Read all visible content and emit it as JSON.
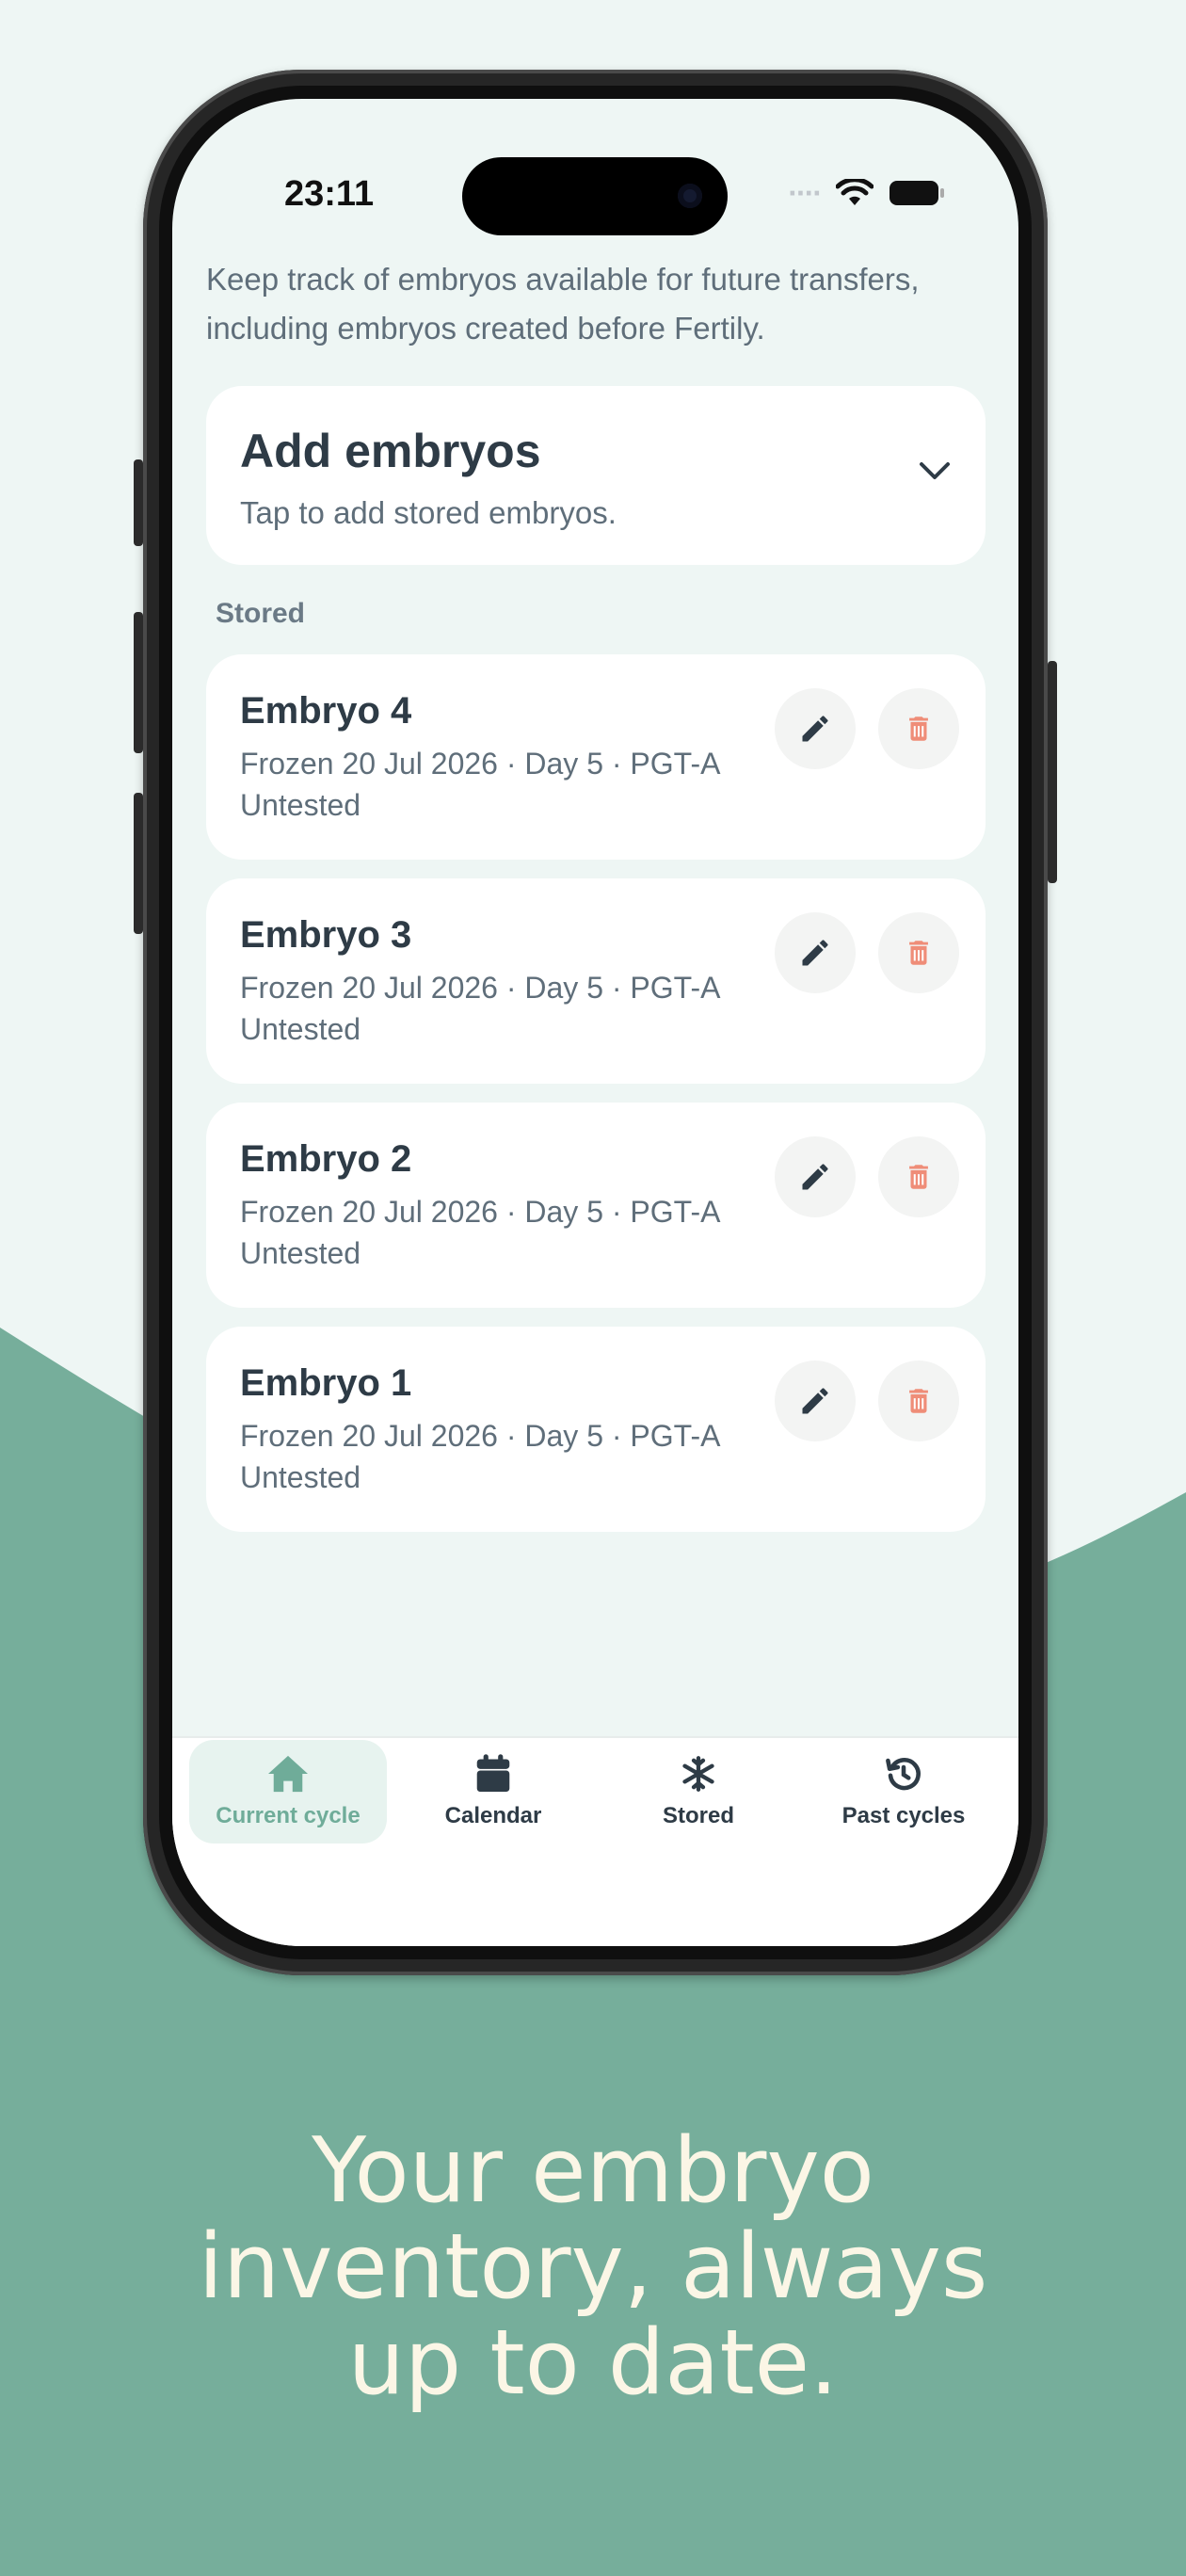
{
  "colors": {
    "background": "#eef6f4",
    "wave": "#76ae9b",
    "accent": "#6fac99",
    "delete": "#ef8d78",
    "text_dark": "#2e3b46",
    "text_muted": "#5f6e7a"
  },
  "status_bar": {
    "time": "23:11",
    "icons": [
      "cellular-icon",
      "wifi-icon",
      "battery-icon"
    ]
  },
  "intro": "Keep track of embryos available for future transfers, including embryos created before Fertily.",
  "add_card": {
    "title": "Add embryos",
    "subtitle": "Tap to add stored embryos.",
    "icon": "chevron-down-icon"
  },
  "section_label": "Stored",
  "embryos": [
    {
      "name": "Embryo 4",
      "details": "Frozen 20 Jul 2026 · Day 5 · PGT-A",
      "status": "Untested"
    },
    {
      "name": "Embryo 3",
      "details": "Frozen 20 Jul 2026 · Day 5 · PGT-A",
      "status": "Untested"
    },
    {
      "name": "Embryo 2",
      "details": "Frozen 20 Jul 2026 · Day 5 · PGT-A",
      "status": "Untested"
    },
    {
      "name": "Embryo 1",
      "details": "Frozen 20 Jul 2026 · Day 5 · PGT-A",
      "status": "Untested"
    }
  ],
  "tabs": [
    {
      "label": "Current cycle",
      "icon": "home-icon",
      "active": true
    },
    {
      "label": "Calendar",
      "icon": "calendar-icon",
      "active": false
    },
    {
      "label": "Stored",
      "icon": "snowflake-icon",
      "active": false
    },
    {
      "label": "Past cycles",
      "icon": "history-icon",
      "active": false
    }
  ],
  "tagline": [
    "Your embryo",
    "inventory, always",
    "up to date."
  ]
}
